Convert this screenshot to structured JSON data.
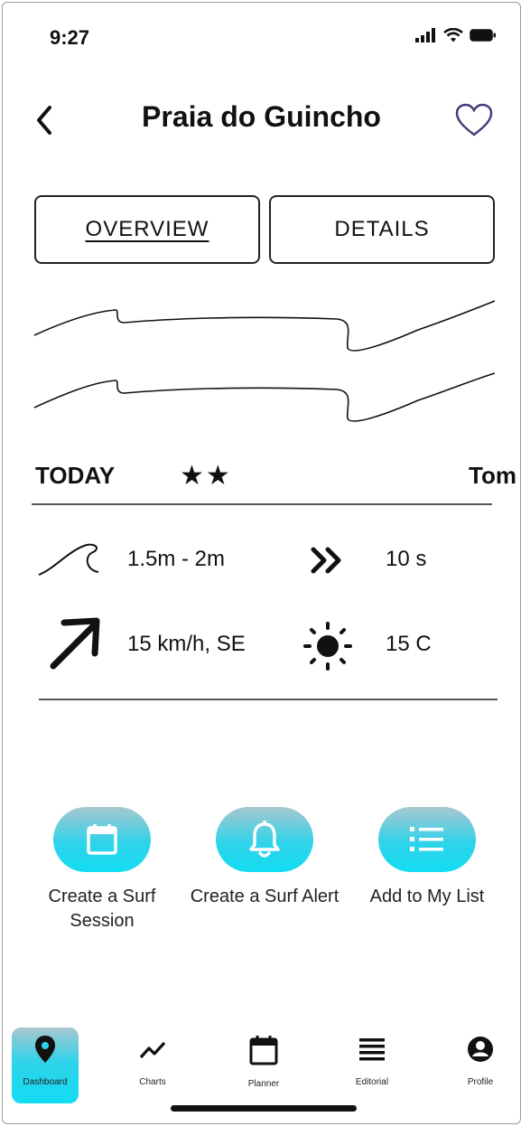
{
  "status": {
    "time": "9:27"
  },
  "header": {
    "title": "Praia do Guincho"
  },
  "tabs": [
    {
      "label": "OVERVIEW",
      "active": true
    },
    {
      "label": "DETAILS",
      "active": false
    }
  ],
  "forecast": {
    "day_label": "TODAY",
    "stars": "★★",
    "next_day_label": "Tom",
    "wave_height": "1.5m - 2m",
    "period": "10 s",
    "wind": "15 km/h, SE",
    "temperature": "15 C"
  },
  "actions": [
    {
      "label": "Create a Surf Session",
      "icon": "calendar-icon"
    },
    {
      "label": "Create a Surf Alert",
      "icon": "bell-icon"
    },
    {
      "label": "Add to My List",
      "icon": "list-icon"
    }
  ],
  "nav": [
    {
      "label": "Dashboard",
      "icon": "map-pin-icon",
      "active": true
    },
    {
      "label": "Charts",
      "icon": "trend-line-icon"
    },
    {
      "label": "Planner",
      "icon": "calendar-icon"
    },
    {
      "label": "Editorial",
      "icon": "lines-icon"
    },
    {
      "label": "Profile",
      "icon": "user-circle-icon"
    }
  ],
  "colors": {
    "accent": "#12dcf2",
    "accent_top": "#a9c7cf",
    "text": "#111111",
    "heart": "#4a3d78"
  }
}
